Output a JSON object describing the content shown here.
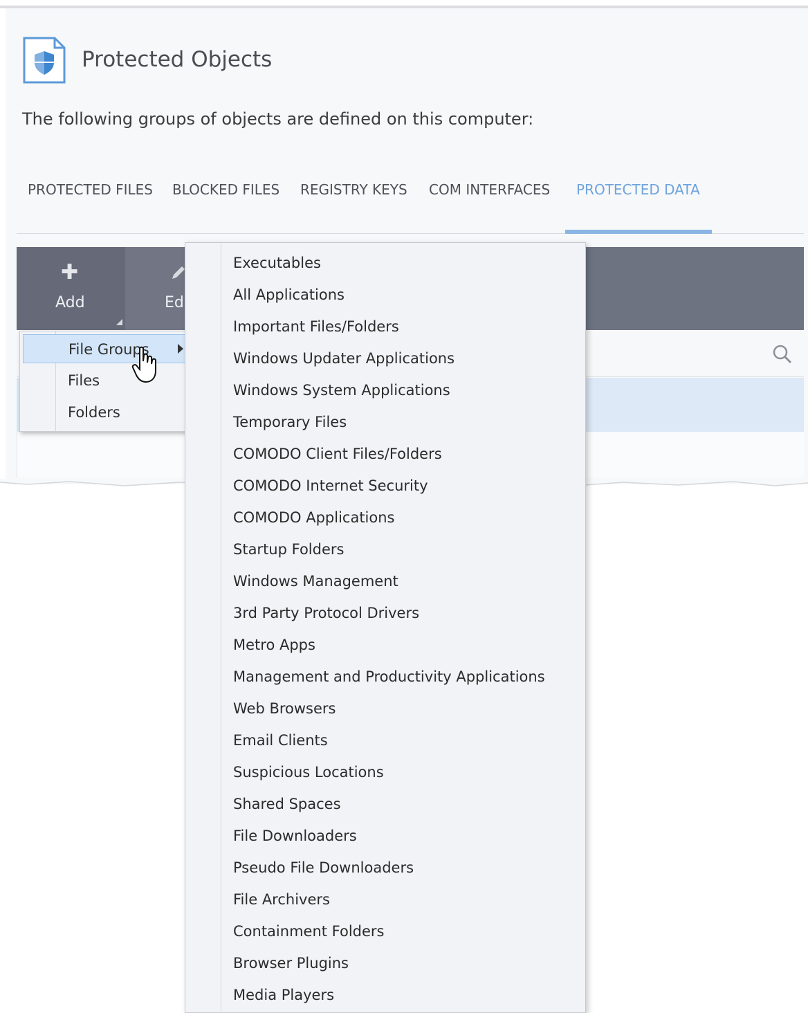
{
  "header": {
    "title": "Protected Objects",
    "subtitle": "The following groups of objects are defined on this computer:",
    "icon": "shield-document-icon"
  },
  "tabs": [
    {
      "label": "PROTECTED FILES",
      "active": false
    },
    {
      "label": "BLOCKED FILES",
      "active": false
    },
    {
      "label": "REGISTRY KEYS",
      "active": false
    },
    {
      "label": "COM INTERFACES",
      "active": false
    },
    {
      "label": "PROTECTED DATA",
      "active": true
    }
  ],
  "toolbar": {
    "add_label": "Add",
    "edit_label": "Ed"
  },
  "add_menu": {
    "items": [
      {
        "label": "File Groups",
        "hovered": true,
        "has_submenu": true
      },
      {
        "label": "Files"
      },
      {
        "label": "Folders"
      }
    ]
  },
  "file_groups_submenu": {
    "items": [
      "Executables",
      "All Applications",
      "Important Files/Folders",
      "Windows Updater Applications",
      "Windows System Applications",
      "Temporary Files",
      "COMODO Client Files/Folders",
      "COMODO Internet Security",
      "COMODO Applications",
      "Startup Folders",
      "Windows Management",
      "3rd Party Protocol Drivers",
      "Metro Apps",
      "Management and Productivity Applications",
      "Web Browsers",
      "Email Clients",
      "Suspicious Locations",
      "Shared Spaces",
      "File Downloaders",
      "Pseudo File Downloaders",
      "File Archivers",
      "Containment Folders",
      "Browser Plugins",
      "Media Players"
    ]
  },
  "colors": {
    "accent": "#6fa3dc",
    "toolbar": "#6e7382",
    "selected_row": "#dde9f6",
    "menu_hover": "#d3e5f8"
  }
}
